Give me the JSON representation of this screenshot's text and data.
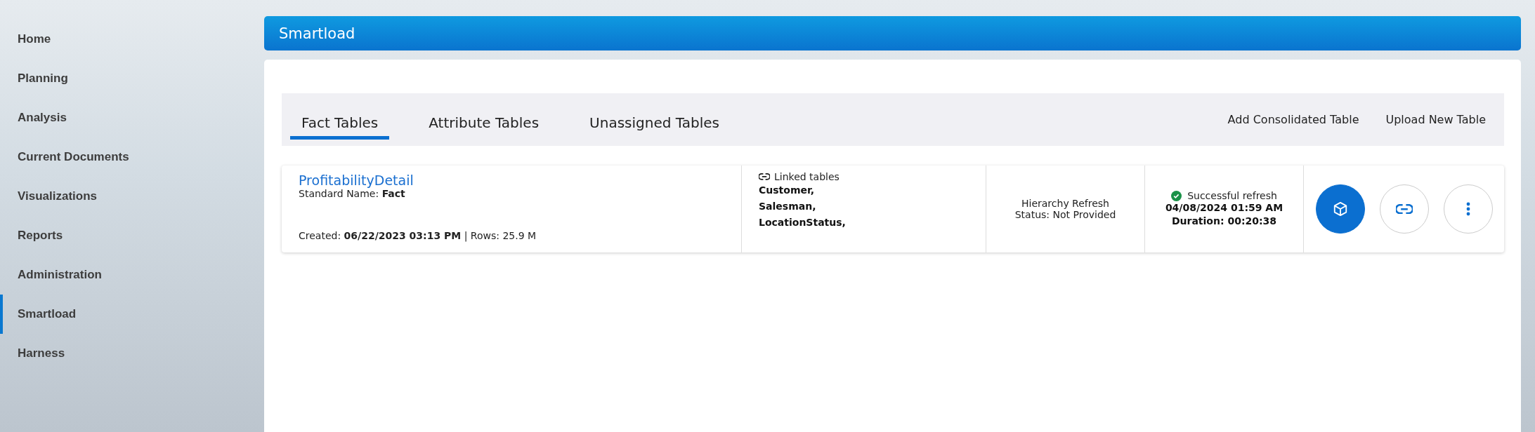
{
  "sidebar": {
    "items": [
      {
        "label": "Home",
        "selected": false
      },
      {
        "label": "Planning",
        "selected": false
      },
      {
        "label": "Analysis",
        "selected": false
      },
      {
        "label": "Current Documents",
        "selected": false
      },
      {
        "label": "Visualizations",
        "selected": false
      },
      {
        "label": "Reports",
        "selected": false
      },
      {
        "label": "Administration",
        "selected": false
      },
      {
        "label": "Smartload",
        "selected": true
      },
      {
        "label": "Harness",
        "selected": false
      }
    ]
  },
  "header": {
    "title": "Smartload"
  },
  "tabs": [
    {
      "label": "Fact Tables",
      "selected": true
    },
    {
      "label": "Attribute Tables",
      "selected": false
    },
    {
      "label": "Unassigned Tables",
      "selected": false
    }
  ],
  "actions": [
    "Add Consolidated Table",
    "Upload New Table"
  ],
  "tables": [
    {
      "name": "ProfitabilityDetail",
      "standard_name": "Standard Name: **Fact**",
      "created": "Created: **06/22/2023 03:13 PM** | Rows: 25.9 M",
      "linked_label": "Linked tables",
      "linked": [
        "Customer,",
        "Salesman,",
        "LocationStatus,"
      ],
      "hierarchy": [
        "Hierarchy Refresh",
        "Status: Not Provided"
      ],
      "refresh_status": "Successful refresh",
      "refresh_date": "04/08/2024 01:59 AM",
      "duration": "Duration: 00:20:38"
    }
  ]
}
